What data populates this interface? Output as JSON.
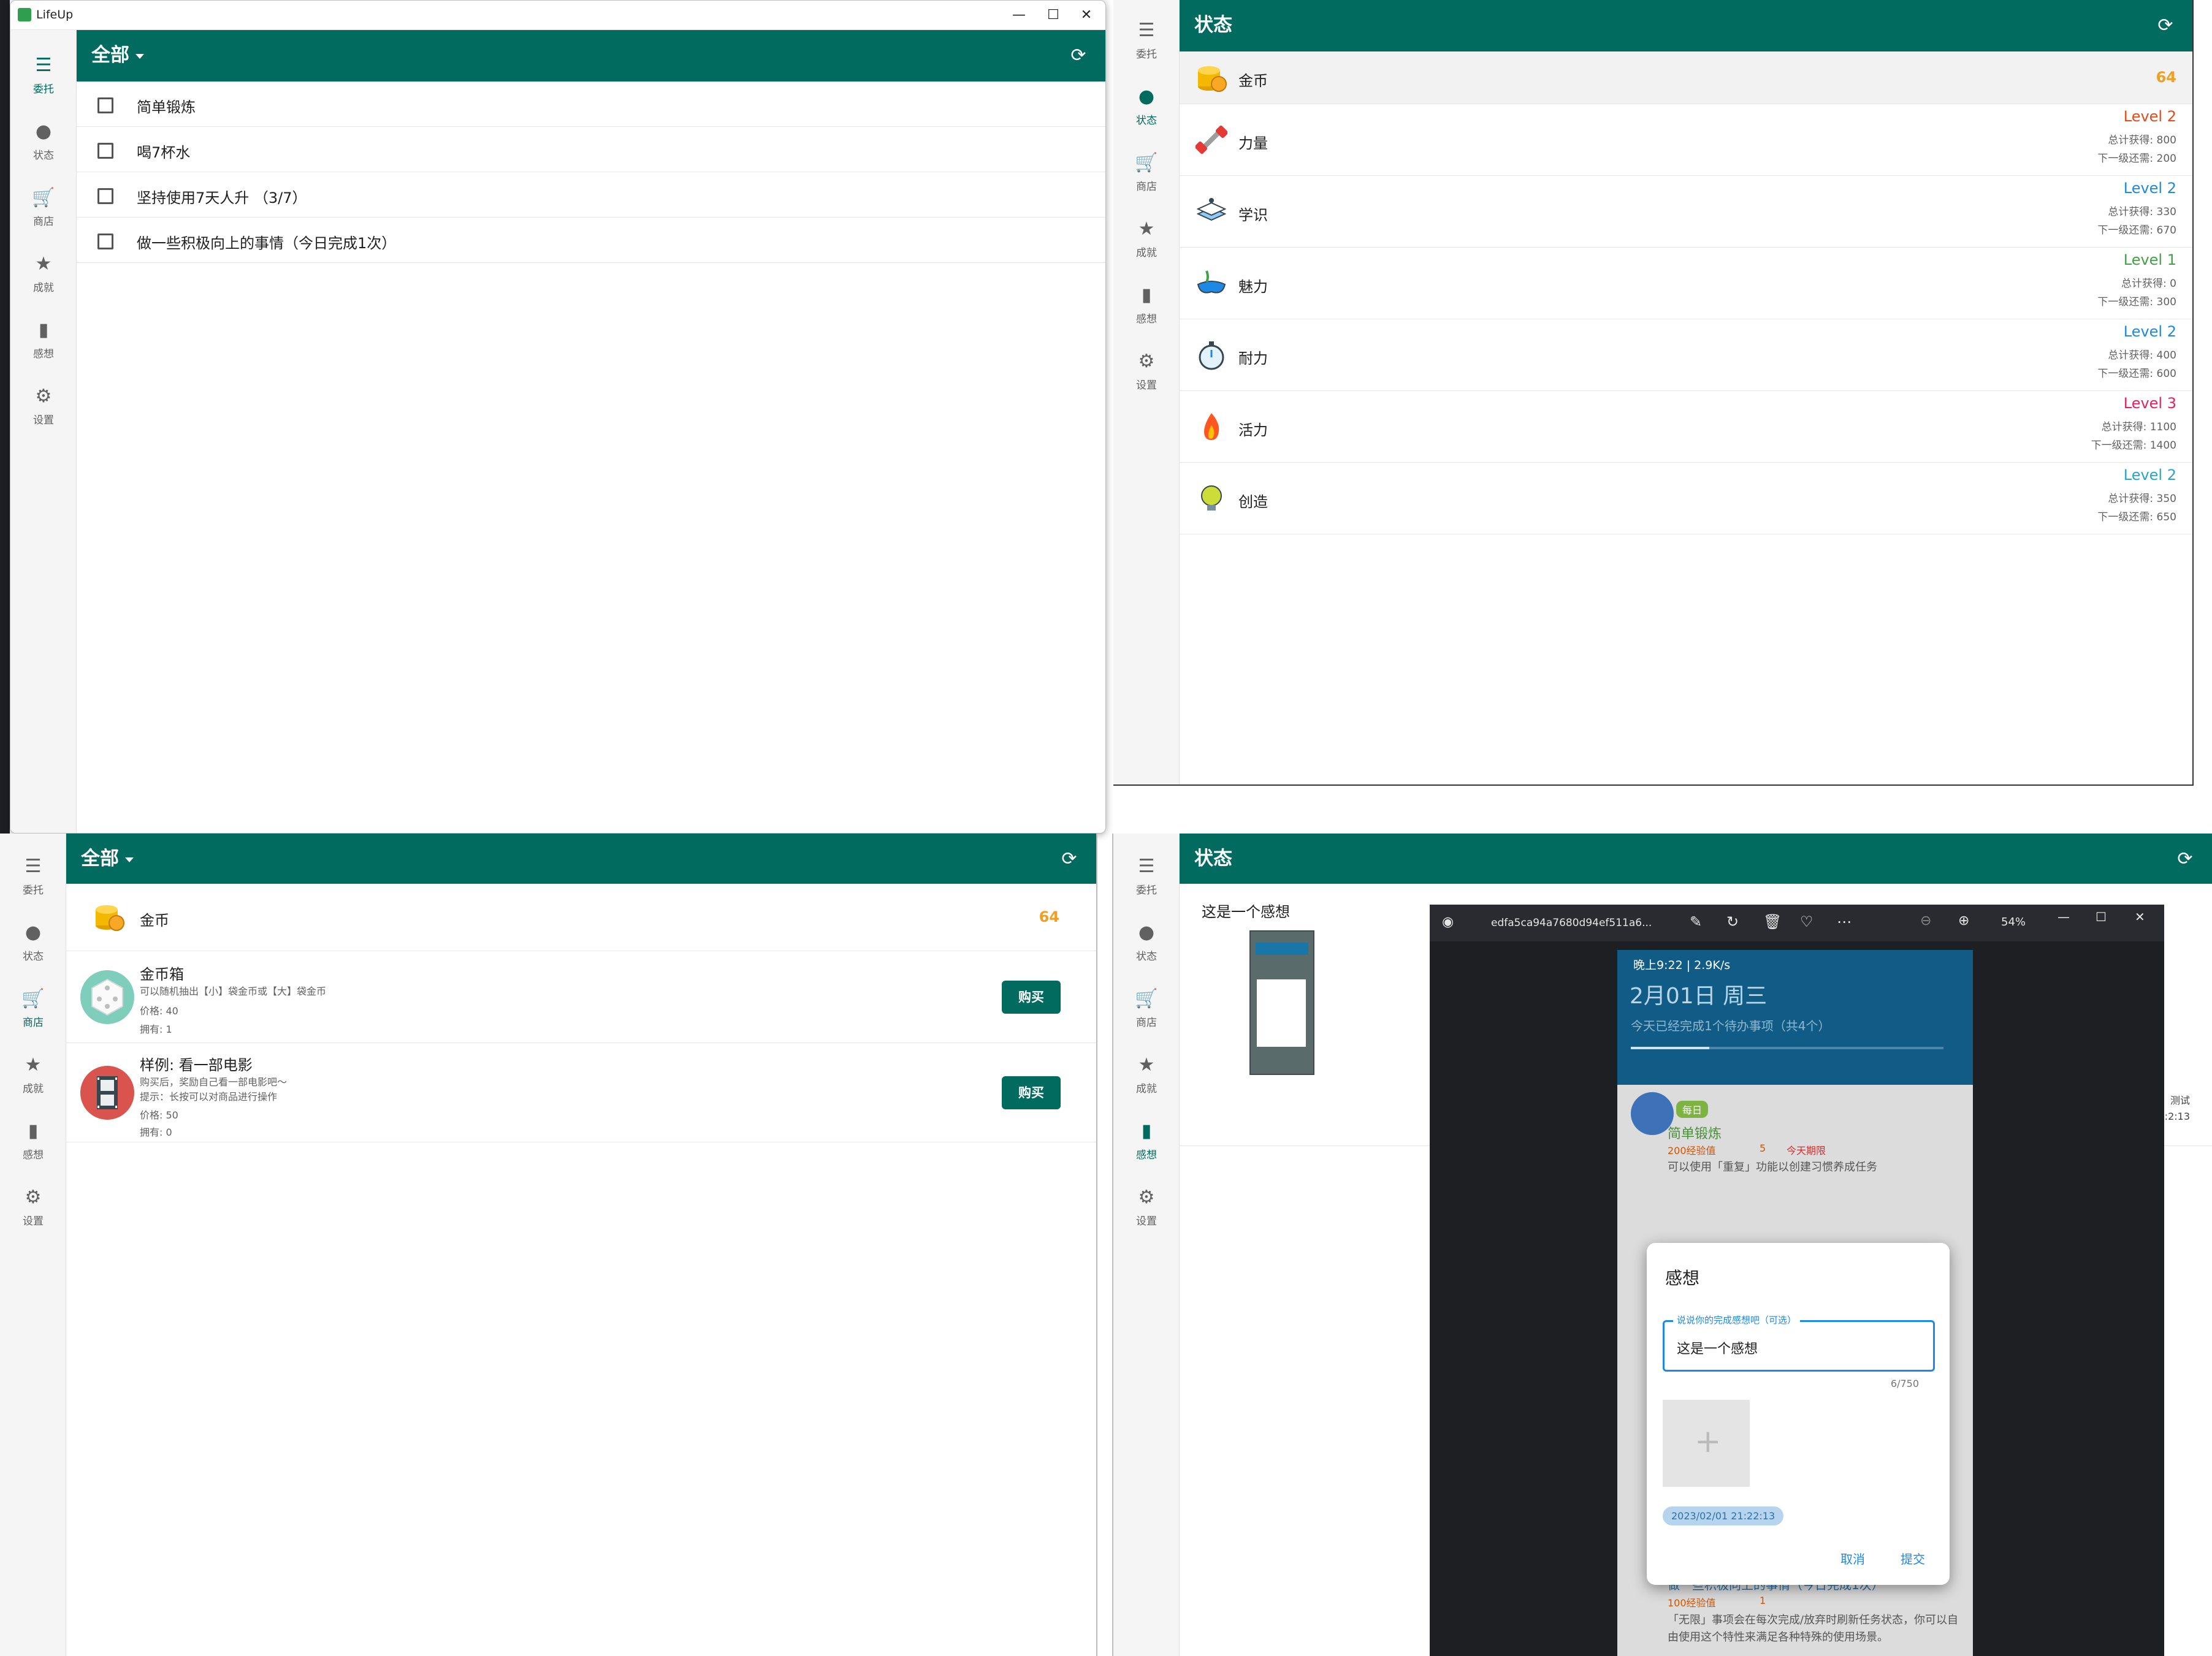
{
  "nav": {
    "items": [
      {
        "key": "commission",
        "label": "委托",
        "icon": "list-icon"
      },
      {
        "key": "status",
        "label": "状态",
        "icon": "person-icon"
      },
      {
        "key": "shop",
        "label": "商店",
        "icon": "cart-icon"
      },
      {
        "key": "achievement",
        "label": "成就",
        "icon": "star-icon"
      },
      {
        "key": "thoughts",
        "label": "感想",
        "icon": "book-icon"
      },
      {
        "key": "settings",
        "label": "设置",
        "icon": "gear-icon"
      }
    ]
  },
  "panel_tasks": {
    "window_title": "LifeUp",
    "window_controls": [
      "—",
      "☐",
      "✕"
    ],
    "filter": "全部",
    "tasks": [
      {
        "text": "简单锻炼",
        "checked": false
      },
      {
        "text": "喝7杯水",
        "checked": false
      },
      {
        "text": "坚持使用7天人升 （3/7）",
        "checked": false
      },
      {
        "text": "做一些积极向上的事情（今日完成1次）",
        "checked": false
      }
    ]
  },
  "panel_status": {
    "title": "状态",
    "coins": {
      "name": "金币",
      "value": "64"
    },
    "attributes": [
      {
        "name": "力量",
        "icon": "dumbbell-icon",
        "level": "Level 2",
        "total": "总计获得: 800",
        "next": "下一级还需: 200",
        "color": "#e64a19"
      },
      {
        "name": "学识",
        "icon": "book-stack-icon",
        "level": "Level 2",
        "total": "总计获得: 330",
        "next": "下一级还需: 670",
        "color": "#1e88e5"
      },
      {
        "name": "魅力",
        "icon": "mask-icon",
        "level": "Level 1",
        "total": "总计获得: 0",
        "next": "下一级还需: 300",
        "color": "#43a047"
      },
      {
        "name": "耐力",
        "icon": "stopwatch-icon",
        "level": "Level 2",
        "total": "总计获得: 400",
        "next": "下一级还需: 600",
        "color": "#1e88e5"
      },
      {
        "name": "活力",
        "icon": "flame-icon",
        "level": "Level 3",
        "total": "总计获得: 1100",
        "next": "下一级还需: 1400",
        "color": "#e91e63"
      },
      {
        "name": "创造",
        "icon": "bulb-icon",
        "level": "Level 2",
        "total": "总计获得: 350",
        "next": "下一级还需: 650",
        "color": "#26a6c9"
      }
    ]
  },
  "panel_shop": {
    "filter": "全部",
    "coins": {
      "name": "金币",
      "value": "64"
    },
    "items": [
      {
        "name": "金币箱",
        "desc": "可以随机抽出【小】袋金币或【大】袋金币",
        "price": "价格: 40",
        "owned": "拥有: 1",
        "buy": "购买",
        "icon": "dice-icon"
      },
      {
        "name": "样例: 看一部电影",
        "desc": "购买后，奖励自己看一部电影吧～",
        "hint": "提示：长按可以对商品进行操作",
        "price": "价格: 50",
        "owned": "拥有: 0",
        "buy": "购买",
        "icon": "film-icon"
      }
    ]
  },
  "panel_thoughts": {
    "title": "状态",
    "entry_text": "这是一个感想",
    "side_text_1": "测试",
    "side_text_2": ":2:13",
    "viewer": {
      "filename": "edfa5ca94a7680d94ef511a6...",
      "zoom": "54%",
      "controls": [
        "—",
        "☐",
        "✕"
      ],
      "phone": {
        "status_time": "晚上9:22 | 2.9K/s",
        "date": "2月01日 周三",
        "summary": "今天已经完成1个待办事项（共4个）",
        "tag": "每日",
        "task1": "简单锻炼",
        "task1_reward": "200经验值",
        "task1_coin": "5",
        "task1_due": "今天期限",
        "task1_desc": "可以使用「重复」功能以创建习惯养成任务",
        "task2": "做一些积极向上的事情（今日完成1次）",
        "task2_reward": "100经验值",
        "task2_coin": "1",
        "task2_desc": "「无限」事项会在每次完成/放弃时刷新任务状态，你可以自由使用这个特性来满足各种特殊的使用场景。"
      },
      "dialog": {
        "title": "感想",
        "field_label": "说说你的完成感想吧（可选）",
        "field_value": "这是一个感想",
        "counter": "6/750",
        "date_chip": "2023/02/01 21:22:13",
        "cancel": "取消",
        "submit": "提交"
      }
    }
  }
}
